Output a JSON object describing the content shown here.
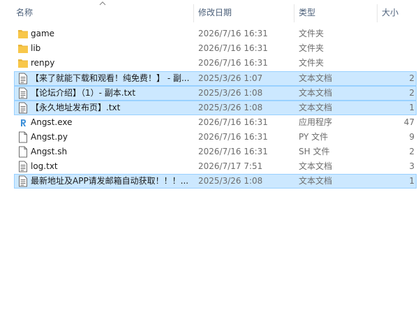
{
  "columns": {
    "name": "名称",
    "date": "修改日期",
    "type": "类型",
    "size": "大小"
  },
  "colors": {
    "selection_bg": "#cce8ff",
    "selection_border": "#99d1ff",
    "folder_yellow": "#f8c74a",
    "header_text": "#4c607a"
  },
  "files": [
    {
      "name": "game",
      "date": "2026/7/16 16:31",
      "type": "文件夹",
      "size": "",
      "icon": "folder-icon",
      "selected": false
    },
    {
      "name": "lib",
      "date": "2026/7/16 16:31",
      "type": "文件夹",
      "size": "",
      "icon": "folder-icon",
      "selected": false
    },
    {
      "name": "renpy",
      "date": "2026/7/16 16:31",
      "type": "文件夹",
      "size": "",
      "icon": "folder-icon",
      "selected": false
    },
    {
      "name": "【来了就能下载和观看！纯免费！】 - 副...",
      "date": "2025/3/26 1:07",
      "type": "文本文档",
      "size": "2",
      "icon": "text-file-icon",
      "selected": true
    },
    {
      "name": "【论坛介绍】（1）- 副本.txt",
      "date": "2025/3/26 1:08",
      "type": "文本文档",
      "size": "2",
      "icon": "text-file-icon",
      "selected": true
    },
    {
      "name": "【永久地址发布页】.txt",
      "date": "2025/3/26 1:08",
      "type": "文本文档",
      "size": "1",
      "icon": "text-file-icon",
      "selected": true
    },
    {
      "name": "Angst.exe",
      "date": "2026/7/16 16:31",
      "type": "应用程序",
      "size": "47",
      "icon": "renpy-app-icon",
      "selected": false
    },
    {
      "name": "Angst.py",
      "date": "2026/7/16 16:31",
      "type": "PY 文件",
      "size": "9",
      "icon": "blank-file-icon",
      "selected": false
    },
    {
      "name": "Angst.sh",
      "date": "2026/7/16 16:31",
      "type": "SH 文件",
      "size": "2",
      "icon": "blank-file-icon",
      "selected": false
    },
    {
      "name": "log.txt",
      "date": "2026/7/17 7:51",
      "type": "文本文档",
      "size": "3",
      "icon": "text-file-icon",
      "selected": false
    },
    {
      "name": "最新地址及APP请发邮箱自动获取！！！...",
      "date": "2025/3/26 1:08",
      "type": "文本文档",
      "size": "1",
      "icon": "text-file-icon",
      "selected": true
    }
  ]
}
